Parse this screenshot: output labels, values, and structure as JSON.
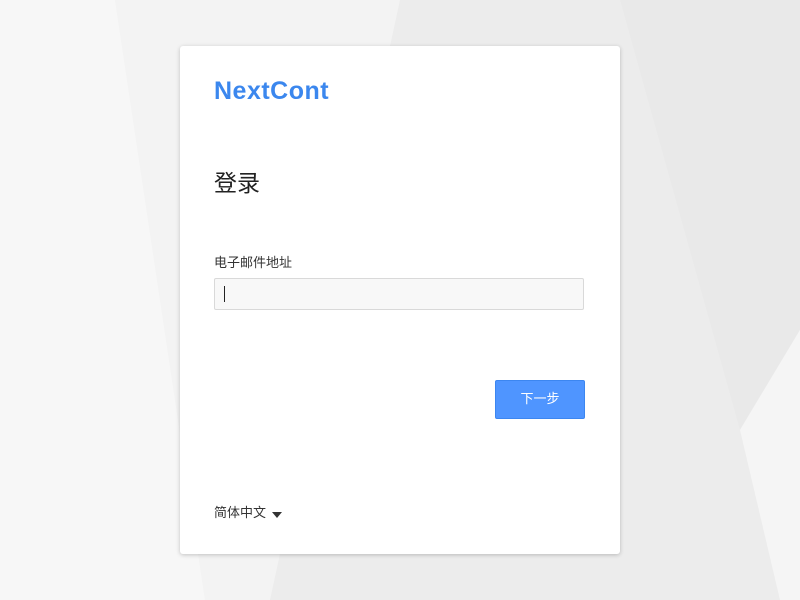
{
  "brand": {
    "logo_text": "NextCont",
    "logo_color": "#3b87ee"
  },
  "login": {
    "title": "登录",
    "email_label": "电子邮件地址",
    "email_value": "",
    "email_placeholder": "",
    "next_button_label": "下一步",
    "next_button_color": "#4f95ff"
  },
  "language": {
    "selected": "简体中文",
    "icon": "caret-down-icon"
  },
  "background": {
    "colors": [
      "#f0f0f0",
      "#f7f7f7",
      "#e9e9e9"
    ]
  }
}
